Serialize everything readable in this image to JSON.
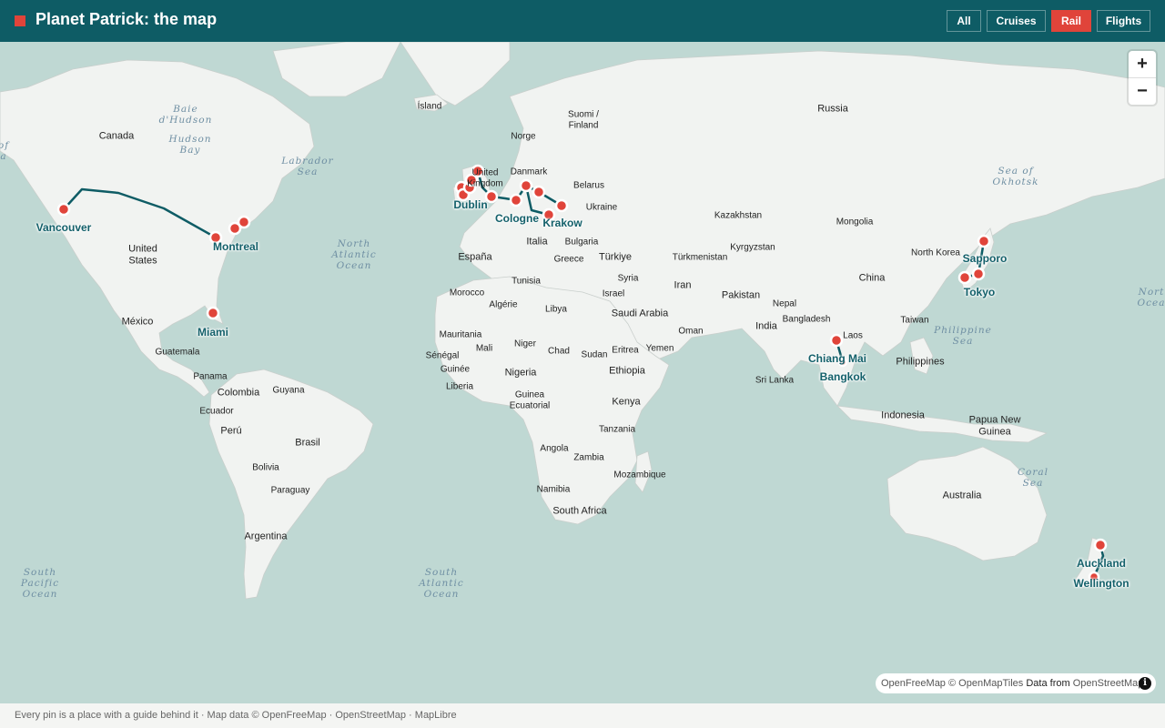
{
  "header": {
    "title": "Planet Patrick: the map",
    "filters": [
      {
        "label": "All",
        "active": false
      },
      {
        "label": "Cruises",
        "active": false
      },
      {
        "label": "Rail",
        "active": true
      },
      {
        "label": "Flights",
        "active": false
      }
    ],
    "brand_color": "#0e5c65",
    "accent_color": "#e0443a"
  },
  "map": {
    "zoom_in": "+",
    "zoom_out": "−",
    "countries": {
      "canada": "Canada",
      "united_states": "United\nStates",
      "mexico": "México",
      "guatemala": "Guatemala",
      "panama": "Panama",
      "colombia": "Colombia",
      "guyana": "Guyana",
      "ecuador": "Ecuador",
      "peru": "Perú",
      "brasil": "Brasil",
      "bolivia": "Bolivia",
      "paraguay": "Paraguay",
      "argentina": "Argentina",
      "island": "Ísland",
      "norge": "Norge",
      "suomi": "Suomi /\nFinland",
      "russia": "Russia",
      "united_kingdom": "United\nKingdom",
      "danmark": "Danmark",
      "belarus": "Belarus",
      "ukraine": "Ukraine",
      "italia": "Italia",
      "bulgaria": "Bulgaria",
      "greece": "Greece",
      "espana": "España",
      "turkiye": "Türkiye",
      "tunisia": "Tunisia",
      "syria": "Syria",
      "morocco": "Morocco",
      "algerie": "Algérie",
      "israel": "Israel",
      "libya": "Libya",
      "iran": "Iran",
      "saudi_arabia": "Saudi Arabia",
      "mauritania": "Mauritania",
      "mali": "Mali",
      "niger": "Niger",
      "chad": "Chad",
      "sudan": "Sudan",
      "eritrea": "Eritrea",
      "yemen": "Yemen",
      "oman": "Oman",
      "senegal": "Sénégal",
      "guinee": "Guinée",
      "liberia": "Liberia",
      "nigeria": "Nigeria",
      "ethiopia": "Ethiopia",
      "guinea_ecuatorial": "Guinea\nEcuatorial",
      "kenya": "Kenya",
      "tanzania": "Tanzania",
      "angola": "Angola",
      "zambia": "Zambia",
      "mozambique": "Mozambique",
      "namibia": "Namibia",
      "south_africa": "South Africa",
      "kazakhstan": "Kazakhstan",
      "mongolia": "Mongolia",
      "kyrgyzstan": "Kyrgyzstan",
      "turkmenistan": "Türkmenistan",
      "pakistan": "Pakistan",
      "nepal": "Nepal",
      "india": "India",
      "bangladesh": "Bangladesh",
      "china": "China",
      "north_korea": "North Korea",
      "taiwan": "Taiwan",
      "laos": "Laos",
      "philippines": "Philippines",
      "sri_lanka": "Sri Lanka",
      "indonesia": "Indonesia",
      "papua_new_guinea": "Papua New\nGuinea",
      "australia": "Australia"
    },
    "water": {
      "baie_dhudson": "Baie\nd'Hudson",
      "hudson_bay": "Hudson\nBay",
      "labrador_sea": "Labrador\nSea",
      "north_atlantic": "North\nAtlantic\nOcean",
      "south_atlantic": "South\nAtlantic\nOcean",
      "south_pacific": "South\nPacific\nOcean",
      "sea_of_okhotsk": "Sea of\nOkhotsk",
      "philippine_sea": "Philippine\nSea",
      "coral_sea": "Coral\nSea",
      "north_pacific": "Nort\nOcea",
      "west_edge": "of\na"
    },
    "cities": {
      "vancouver": "Vancouver",
      "montreal": "Montreal",
      "miami": "Miami",
      "dublin": "Dublin",
      "cologne": "Cologne",
      "krakow": "Krakow",
      "sapporo": "Sapporo",
      "tokyo": "Tokyo",
      "chiang_mai": "Chiang Mai",
      "bangkok": "Bangkok",
      "auckland": "Auckland",
      "wellington": "Wellington"
    },
    "attribution": {
      "openfreemap": "OpenFreeMap",
      "openmaptiles": "© OpenMapTiles",
      "data_from": "Data from",
      "osm": "OpenStreetMap",
      "info": "i"
    }
  },
  "footer": {
    "text": "Every pin is a place with a guide behind it · Map data © OpenFreeMap · OpenStreetMap · MapLibre"
  }
}
